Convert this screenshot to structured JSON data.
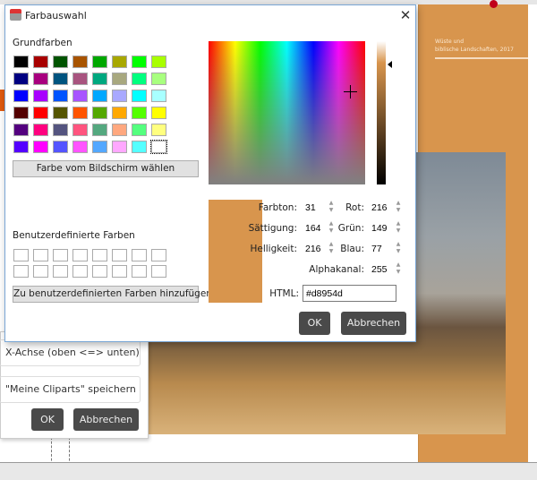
{
  "dialog": {
    "title": "Farbauswahl",
    "close": "✕",
    "basic_colors_label": "Grundfarben",
    "pick_screen_button": "Farbe vom Bildschirm wählen",
    "custom_colors_label": "Benutzerdefinierte Farben",
    "add_custom_button": "Zu benutzerdefinierten Farben hinzufügen",
    "ok": "OK",
    "cancel": "Abbrechen",
    "basic_colors": [
      [
        "#000000",
        "#a80000",
        "#005400",
        "#a85400",
        "#00a800",
        "#a8a800",
        "#00ff00",
        "#a8ff00"
      ],
      [
        "#000080",
        "#a8007f",
        "#00547f",
        "#a8547f",
        "#00a87f",
        "#a8a87f",
        "#00ff7f",
        "#a8ff7f"
      ],
      [
        "#0000ff",
        "#a800ff",
        "#0054ff",
        "#a854ff",
        "#00a8ff",
        "#a8a8ff",
        "#00ffff",
        "#a8ffff"
      ],
      [
        "#540000",
        "#ff0000",
        "#545400",
        "#ff5400",
        "#54a800",
        "#ffa800",
        "#54ff00",
        "#ffff00"
      ],
      [
        "#54007f",
        "#ff007f",
        "#54547f",
        "#ff547f",
        "#54a87f",
        "#ffa87f",
        "#54ff7f",
        "#ffff7f"
      ],
      [
        "#5400ff",
        "#ff00ff",
        "#5454ff",
        "#ff54ff",
        "#54a8ff",
        "#ffa8ff",
        "#54ffff",
        "#ffffff"
      ]
    ],
    "fields": {
      "hue_label": "Farbton:",
      "hue": "31",
      "sat_label": "Sättigung:",
      "sat": "164",
      "lum_label": "Helligkeit:",
      "lum": "216",
      "red_label": "Rot:",
      "red": "216",
      "green_label": "Grün:",
      "green": "149",
      "blue_label": "Blau:",
      "blue": "77",
      "alpha_label": "Alphakanal:",
      "alpha": "255",
      "html_label": "HTML:",
      "html": "#d8954d"
    },
    "current_color": "#d8954d"
  },
  "background": {
    "flip_option": "X-Achse (oben <=> unten)",
    "save_option": "\"Meine Cliparts\" speichern",
    "ok": "OK",
    "cancel": "Abbrechen",
    "page_text": "Wüste und\nbiblische Landschaften, 2017"
  }
}
